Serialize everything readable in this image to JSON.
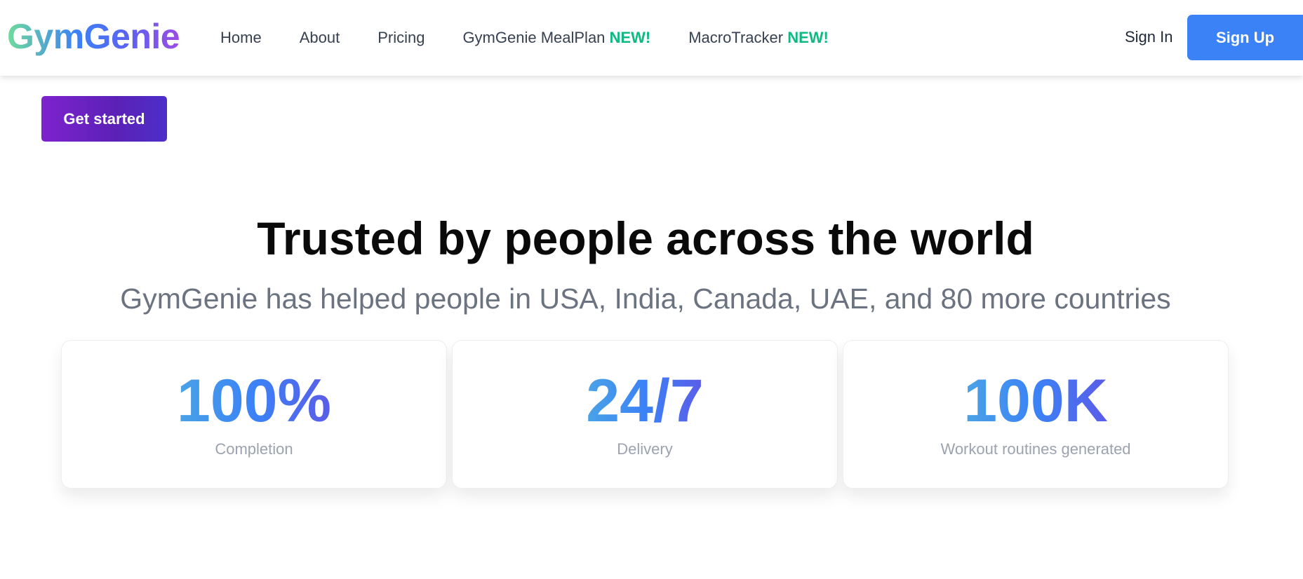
{
  "header": {
    "logo": "GymGenie",
    "nav": [
      {
        "label": "Home",
        "badge": ""
      },
      {
        "label": "About",
        "badge": ""
      },
      {
        "label": "Pricing",
        "badge": ""
      },
      {
        "label": "GymGenie MealPlan",
        "badge": "NEW!"
      },
      {
        "label": "MacroTracker",
        "badge": "NEW!"
      }
    ],
    "sign_in": "Sign In",
    "sign_up": "Sign Up"
  },
  "hero": {
    "cta": "Get started"
  },
  "trust": {
    "title": "Trusted by people across the world",
    "subtitle": "GymGenie has helped people in USA, India, Canada, UAE, and 80 more countries",
    "stats": [
      {
        "value": "100%",
        "label": "Completion"
      },
      {
        "value": "24/7",
        "label": "Delivery"
      },
      {
        "value": "100K",
        "label": "Workout routines generated"
      }
    ]
  },
  "colors": {
    "accent_blue": "#3b82f6",
    "badge_green": "#10b981",
    "cta_purple": "#7e22ce",
    "muted_text": "#6b7280"
  }
}
